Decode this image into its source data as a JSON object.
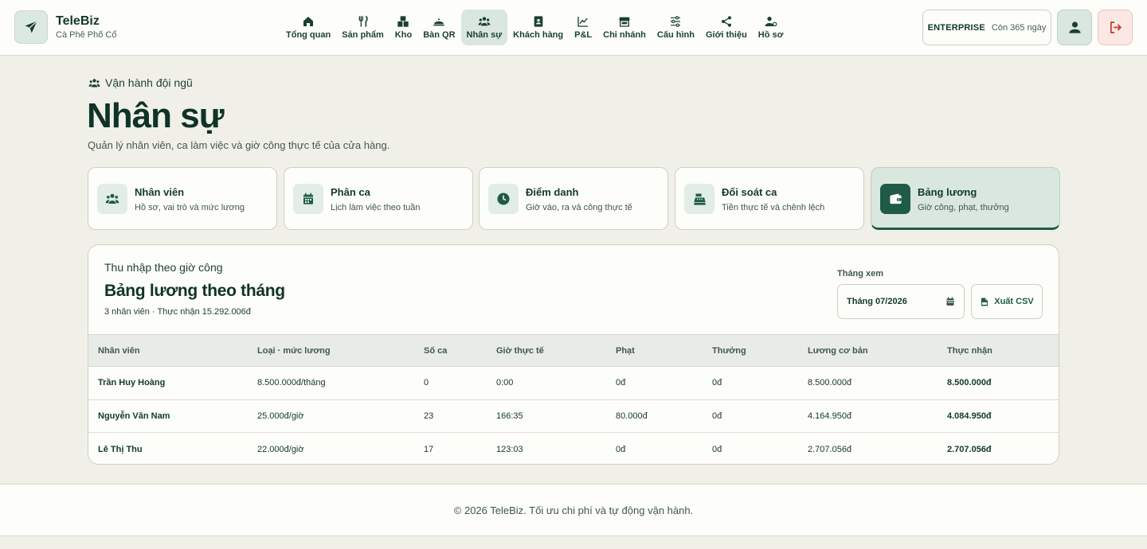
{
  "brand": {
    "name": "TeleBiz",
    "store": "Cà Phê Phố Cổ",
    "icon": "paper-plane-icon"
  },
  "nav": {
    "items": [
      {
        "label": "Tổng quan",
        "icon": "home-icon"
      },
      {
        "label": "Sản phẩm",
        "icon": "utensils-icon"
      },
      {
        "label": "Kho",
        "icon": "boxes-icon"
      },
      {
        "label": "Bàn QR",
        "icon": "cloche-icon"
      },
      {
        "label": "Nhân sự",
        "icon": "users-icon"
      },
      {
        "label": "Khách hàng",
        "icon": "address-book-icon"
      },
      {
        "label": "P&L",
        "icon": "line-chart-icon"
      },
      {
        "label": "Chi nhánh",
        "icon": "store-icon"
      },
      {
        "label": "Cấu hình",
        "icon": "sliders-icon"
      },
      {
        "label": "Giới thiệu",
        "icon": "share-icon"
      },
      {
        "label": "Hồ sơ",
        "icon": "user-gear-icon"
      }
    ],
    "active": "Nhân sự"
  },
  "plan": {
    "tier": "ENTERPRISE",
    "remaining": "Còn 365 ngày"
  },
  "header_actions": {
    "user_icon": "user-icon",
    "logout_icon": "logout-icon"
  },
  "page": {
    "eyebrow": "Vận hành đội ngũ",
    "title": "Nhân sự",
    "subtitle": "Quản lý nhân viên, ca làm việc và giờ công thực tế của cửa hàng."
  },
  "modules": [
    {
      "title": "Nhân viên",
      "desc": "Hồ sơ, vai trò và mức lương",
      "icon": "users-icon"
    },
    {
      "title": "Phân ca",
      "desc": "Lịch làm việc theo tuần",
      "icon": "calendar-icon"
    },
    {
      "title": "Điểm danh",
      "desc": "Giờ vào, ra và công thực tế",
      "icon": "clock-icon"
    },
    {
      "title": "Đối soát ca",
      "desc": "Tiền thực tế và chênh lệch",
      "icon": "cash-register-icon"
    },
    {
      "title": "Bảng lương",
      "desc": "Giờ công, phạt, thưởng",
      "icon": "wallet-icon"
    }
  ],
  "active_module": "Bảng lương",
  "payroll": {
    "eyebrow": "Thu nhập theo giờ công",
    "title": "Bảng lương theo tháng",
    "summary": "3 nhân viên · Thực nhận 15.292.006đ",
    "month_label": "Tháng xem",
    "month_value": "Tháng 07/2026",
    "export_label": "Xuất CSV",
    "columns": [
      "Nhân viên",
      "Loại · mức lương",
      "Số ca",
      "Giờ thực tế",
      "Phạt",
      "Thưởng",
      "Lương cơ bản",
      "Thực nhận"
    ],
    "rows": [
      [
        "Trần Huy Hoàng",
        "8.500.000đ/tháng",
        "0",
        "0:00",
        "0đ",
        "0đ",
        "8.500.000đ",
        "8.500.000đ"
      ],
      [
        "Nguyễn Văn Nam",
        "25.000đ/giờ",
        "23",
        "166:35",
        "80.000đ",
        "0đ",
        "4.164.950đ",
        "4.084.950đ"
      ],
      [
        "Lê Thị Thu",
        "22.000đ/giờ",
        "17",
        "123:03",
        "0đ",
        "0đ",
        "2.707.056đ",
        "2.707.056đ"
      ]
    ]
  },
  "footer": {
    "text": "© 2026 TeleBiz. Tối ưu chi phí và tự động vận hành."
  },
  "colors": {
    "accent": "#1f5b47",
    "accent_light": "#d9e7de",
    "background": "#f1f0e8",
    "danger_light": "#fbe7e3",
    "danger": "#c0392b"
  }
}
